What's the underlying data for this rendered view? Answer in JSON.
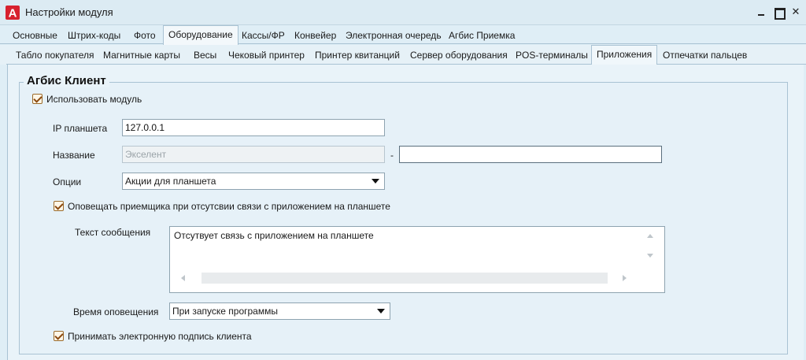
{
  "window": {
    "title": "Настройки модуля",
    "minimize_symbol": "",
    "maximize_symbol": "",
    "close_symbol": "✕",
    "icon": "agbis-logo-icon",
    "icon_letter": "A",
    "accent_color": "#d7212e"
  },
  "tabs_main": [
    "Основные",
    "Штрих-коды",
    "Фото",
    "Оборудование",
    "Кассы/ФР",
    "Конвейер",
    "Электронная очередь",
    "Агбис Приемка"
  ],
  "tabs_main_active": "Оборудование",
  "tabs_equipment": [
    "Табло покупателя",
    "Магнитные карты",
    "Весы",
    "Чековый принтер",
    "Принтер квитанций",
    "Сервер оборудования",
    "POS-терминалы",
    "Приложения",
    "Отпечатки пальцев"
  ],
  "tabs_equipment_active": "Приложения",
  "group": {
    "title": "Агбис Клиент",
    "use_module_label": "Использовать модуль",
    "use_module_checked": true,
    "ip_label": "IP планшета",
    "ip_value": "127.0.0.1",
    "name_label": "Название",
    "name_value": "Экселент",
    "name_separator": "-",
    "name_suffix_value": "",
    "options_label": "Опции",
    "options_value": "Акции для планшета",
    "notify_label": "Оповещать приемщика при отсутсвии связи с приложением на планшете",
    "notify_checked": true,
    "message_label": "Текст сообщения",
    "message_value": "Отсутвует связь с приложением на планшете",
    "notify_time_label": "Время оповещения",
    "notify_time_value": "При запуске программы",
    "signature_label": "Принимать электронную подпись клиента",
    "signature_checked": true
  }
}
